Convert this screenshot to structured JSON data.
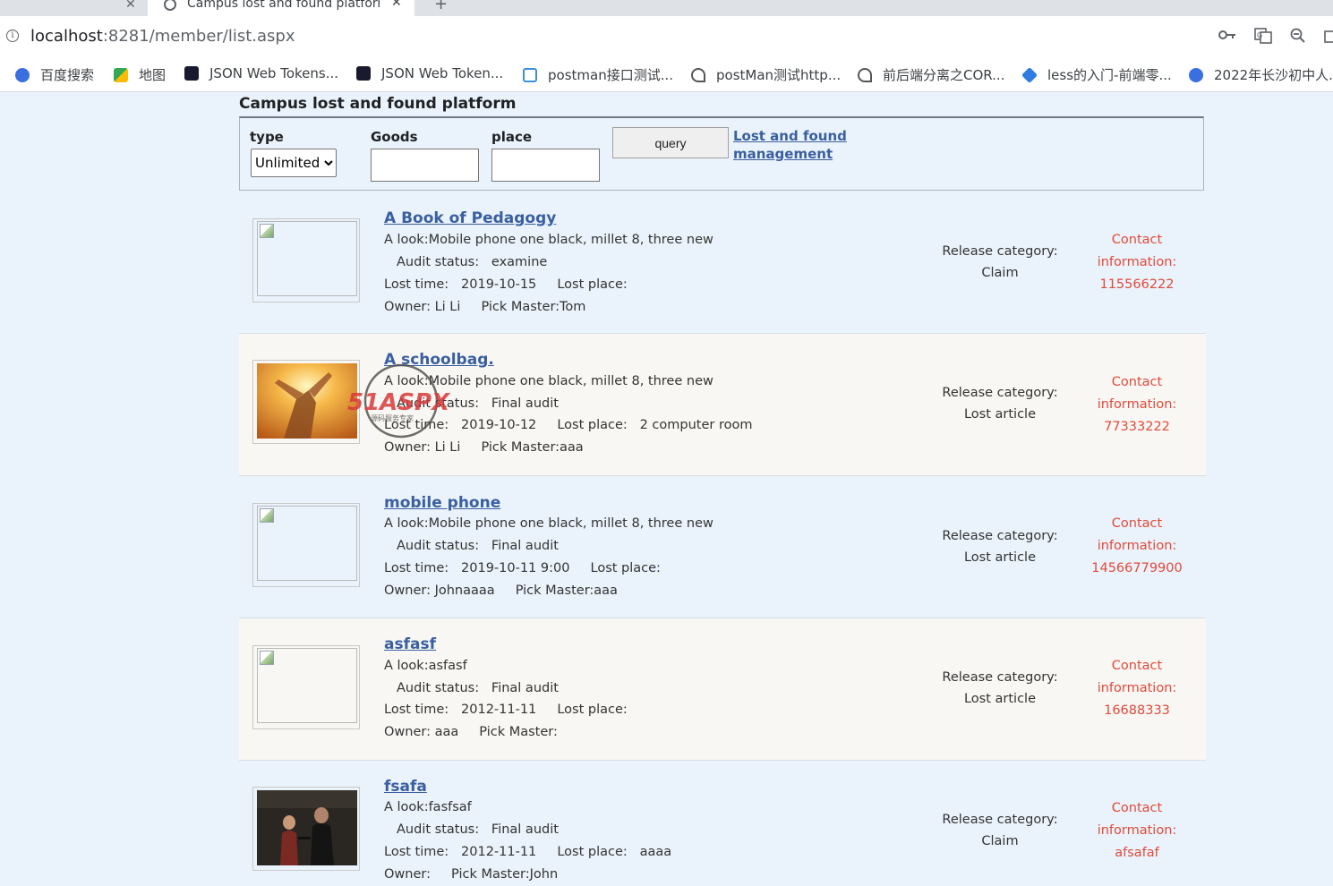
{
  "browser": {
    "tab_title": "Campus lost and found platform",
    "url_host": "localhost",
    "url_path": ":8281/member/list.aspx",
    "bookmarks": [
      {
        "label": "百度搜索",
        "color": "#3b6fe0"
      },
      {
        "label": "地图",
        "color": "#34a853"
      },
      {
        "label": "JSON Web Tokens...",
        "color": "#1a1a2e"
      },
      {
        "label": "JSON Web Token...",
        "color": "#1a1a2e"
      },
      {
        "label": "postman接口测试...",
        "color": "#3b8fe0"
      },
      {
        "label": "postMan测试http...",
        "color": "#555555"
      },
      {
        "label": "前后端分离之COR...",
        "color": "#555555"
      },
      {
        "label": "less的入门-前端零...",
        "color": "#2f7de1"
      },
      {
        "label": "2022年长沙初中人...",
        "color": "#3b6fe0"
      }
    ]
  },
  "page": {
    "title": "Campus lost and found platform",
    "search": {
      "type_label": "type",
      "type_value": "Unlimited",
      "goods_label": "Goods",
      "place_label": "place",
      "query_label": "query",
      "manage_link": "Lost and found management"
    },
    "items": [
      {
        "title": "A Book of Pedagogy",
        "look": "A look:Mobile phone one black, millet 8, three new",
        "audit": "Audit status:   examine",
        "lost": "Lost time:   2019-10-15     Lost place: ",
        "owner": "Owner: Li Li     Pick Master:Tom",
        "cat_label": "Release category:",
        "cat_value": "Claim",
        "contact_label": "Contact information:",
        "contact_value": "115566222",
        "image": "broken"
      },
      {
        "title": "A schoolbag.",
        "look": "A look:Mobile phone one black, millet 8, three new",
        "audit": "Audit status:   Final audit",
        "lost": "Lost time:   2019-10-12     Lost place:   2 computer room",
        "owner": "Owner: Li Li     Pick Master:aaa",
        "cat_label": "Release category:",
        "cat_value": "Lost article",
        "contact_label": "Contact information:",
        "contact_value": "77333222",
        "image": "photo-sunrise"
      },
      {
        "title": "mobile phone",
        "look": "A look:Mobile phone one black, millet 8, three new",
        "audit": "Audit status:   Final audit",
        "lost": "Lost time:   2019-10-11 9:00     Lost place: ",
        "owner": "Owner: Johnaaaa     Pick Master:aaa",
        "cat_label": "Release category:",
        "cat_value": "Lost article",
        "contact_label": "Contact information:",
        "contact_value": "14566779900",
        "image": "broken"
      },
      {
        "title": "asfasf",
        "look": "A look:asfasf",
        "audit": "Audit status:   Final audit",
        "lost": "Lost time:   2012-11-11     Lost place: ",
        "owner": "Owner: aaa     Pick Master: ",
        "cat_label": "Release category:",
        "cat_value": "Lost article",
        "contact_label": "Contact information:",
        "contact_value": "16688333",
        "image": "broken"
      },
      {
        "title": "fsafa",
        "look": "A look:fasfsaf",
        "audit": "Audit status:   Final audit",
        "lost": "Lost time:   2012-11-11     Lost place:   aaaa",
        "owner": "Owner:     Pick Master:John",
        "cat_label": "Release category:",
        "cat_value": "Claim",
        "contact_label": "Contact information:",
        "contact_value": "afsafaf",
        "image": "photo-dark"
      }
    ]
  },
  "watermark": {
    "brand": "51ASPX",
    "sub": "源码服务专家"
  }
}
